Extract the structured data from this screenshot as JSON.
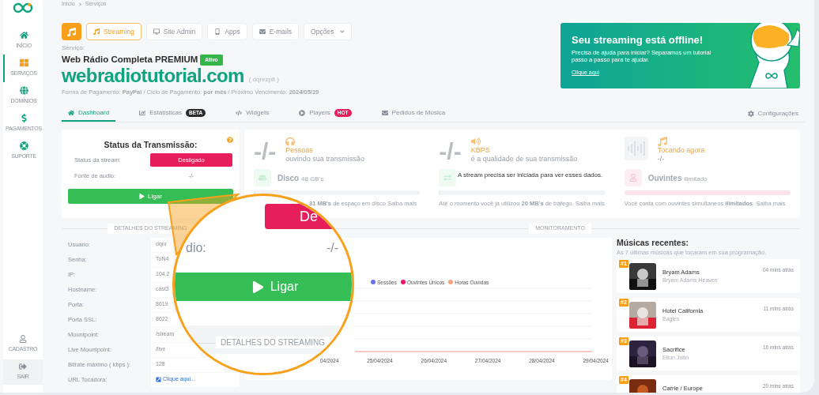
{
  "sidebar": {
    "items": [
      {
        "label": "INÍCIO",
        "selected": false
      },
      {
        "label": "SERVIÇOS",
        "selected": true
      },
      {
        "label": "DOMÍNIOS",
        "selected": false
      },
      {
        "label": "PAGAMENTOS",
        "selected": false
      },
      {
        "label": "SUPORTE",
        "selected": false
      }
    ],
    "bottom": [
      {
        "label": "CADASTRO"
      },
      {
        "label": "SAIR"
      }
    ]
  },
  "breadcrumb": [
    "Início",
    "Serviços"
  ],
  "service_nav": [
    {
      "label": "Streaming",
      "selected": true
    },
    {
      "label": "Site Admin",
      "selected": false
    },
    {
      "label": "Apps",
      "selected": false
    },
    {
      "label": "E-mails",
      "selected": false
    },
    {
      "label": "Opções",
      "selected": false
    }
  ],
  "service": {
    "label": "Serviço:",
    "plan": "Web Rádio Completa PREMIUM",
    "status": "Ativo",
    "domain": "webradiotutorial.com",
    "login": "( dqnrzplt )",
    "payment": "Forma de Pagamento: **PayPal** / Ciclo de Pagamento: **por mês** / Próximo Vencimento: **2024/05/29**"
  },
  "banner": {
    "title": "Seu streaming está offline!",
    "text": "Precisa de ajuda para iniciar? Separamos um tutorial passo a passo para te ajudar.",
    "link": "Clique aqui"
  },
  "tabs": [
    {
      "label": "Dashboard",
      "selected": true
    },
    {
      "label": "Estatísticas",
      "selected": false,
      "badge": {
        "label": "BETA",
        "color": "#2b2b2b"
      }
    },
    {
      "label": "Widgets",
      "selected": false
    },
    {
      "label": "Players",
      "selected": false,
      "badge": {
        "label": "HOT",
        "color": "#e61e5a"
      }
    },
    {
      "label": "Pedidos de Música",
      "selected": false
    }
  ],
  "settings": "Configurações",
  "status_card": {
    "title": "Status da Transmissão:",
    "rows": [
      {
        "label": "Status da stream:",
        "value": "Desligado",
        "kind": "pill"
      },
      {
        "label": "Fonte de audio:",
        "value": "-/-",
        "kind": "text"
      }
    ],
    "button": "Ligar"
  },
  "stats": {
    "top": [
      {
        "value": "-/-",
        "title": "Pessoas",
        "subtitle": "ouvindo sua transmissão"
      },
      {
        "value": "-/-",
        "title": "KBPS",
        "subtitle": "é a qualidade de sua transmissão"
      },
      {
        "title": "Tocando agora",
        "subtitle": "-/-"
      }
    ],
    "bottom": [
      {
        "title": "Disco",
        "extra": "48 GB's",
        "level": 0.01,
        "note": "**31 MB's** de espaço em disco Saiba mais"
      },
      {
        "level": 0.01,
        "note": "Até o momento você já utilizou **20 MB's** de tráfego. Saiba mais"
      },
      {
        "title": "Ouvintes",
        "extra": "ilimitado",
        "level": 1,
        "note": "Você conta com ouvintes simultaneos **ilimitados**. Saiba mais"
      }
    ],
    "message": "A stream precisa ser iniciada para ver esses dados."
  },
  "details_heading": "DETALHES DO STREAMING",
  "monitor_heading": "MONITORAMENTO",
  "details": [
    {
      "label": "Usuario:",
      "value": "dqnr"
    },
    {
      "label": "Senha:",
      "value": "ToN4"
    },
    {
      "label": "IP:",
      "value": "104.2"
    },
    {
      "label": "Hostname:",
      "value": "cast3"
    },
    {
      "label": "Porta:",
      "value": "8619"
    },
    {
      "label": "Porta SSL:",
      "value": "8622"
    },
    {
      "label": "Mountpoint:",
      "value": "/stream"
    },
    {
      "label": "Live Mountpoint:",
      "value": "/live"
    },
    {
      "label": "Bitrate máximo ( kbps ):",
      "value": "128"
    },
    {
      "label": "URL Tocadora:",
      "value": "Clique aqui...",
      "kind": "link"
    }
  ],
  "chart": {
    "legend": [
      {
        "label": "Sessões",
        "color": "#6f6ff2"
      },
      {
        "label": "Ouvintes Únicos",
        "color": "#ee1469"
      },
      {
        "label": "Horas Ouvidas",
        "color": "#f8a27e"
      }
    ],
    "x_labels": [
      "04/2024",
      "25/04/2024",
      "26/04/2024",
      "27/04/2024",
      "28/04/2024",
      "29/04/2024"
    ]
  },
  "recent": {
    "title": "Músicas recentes:",
    "subtitle": "As 7 últimas músicas que tocaram em sua programação.",
    "songs": [
      {
        "rank": "#1",
        "title": "Bryam Adams",
        "artist": "Bryam Adams Heaven",
        "time": "04 mins atrás"
      },
      {
        "rank": "#2",
        "title": "Hotel California",
        "artist": "Eagles",
        "time": "11 mins atrás"
      },
      {
        "rank": "#3",
        "title": "Sacrifice",
        "artist": "Elton John",
        "time": "16 mins atrás"
      },
      {
        "rank": "#4",
        "title": "Carrie / Europe",
        "time": "20 mins atrás"
      }
    ]
  },
  "magnifier": {
    "status_value": "De",
    "audio_label": "dio:",
    "audio_value": "-/-",
    "button": "Ligar",
    "section": "DETALHES DO STREAMING"
  }
}
